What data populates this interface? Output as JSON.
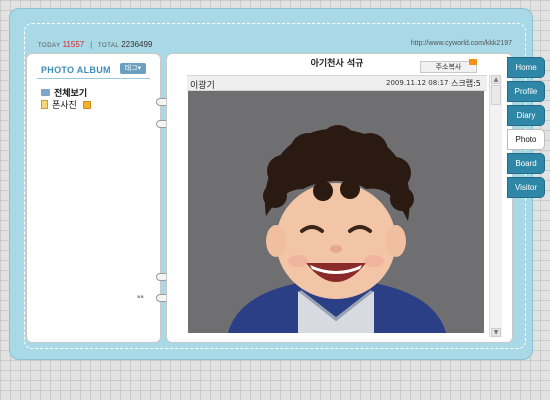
{
  "header": {
    "today_label": "TODAY",
    "today_value": "11557",
    "separator": "|",
    "total_label": "TOTAL",
    "total_value": "2236499",
    "url": "http://www.cyworld.com/kkk2197"
  },
  "album": {
    "title": "PHOTO ALBUM",
    "tag_button": "태그▾",
    "folders": [
      {
        "label": "전체보기",
        "icon": "folder-icon"
      },
      {
        "label": "폰사진",
        "icon": "document-icon"
      }
    ],
    "tiny_mark": "▪▪"
  },
  "post": {
    "title": "아기천사 석규",
    "address_button": "주소복사",
    "author": "이광기",
    "datetime": "2009.11.12 08:17",
    "scrap": "스크랩:5",
    "photo_subject": "photo of a smiling curly-haired boy"
  },
  "tabs": [
    {
      "label": "Home"
    },
    {
      "label": "Profile"
    },
    {
      "label": "Diary"
    },
    {
      "label": "Photo",
      "active": true
    },
    {
      "label": "Board"
    },
    {
      "label": "Visitor"
    }
  ],
  "colors": {
    "frame": "#a9d8e6",
    "tab": "#2f87a7",
    "today_accent": "#d4282d",
    "album_heading": "#3d8db5"
  }
}
